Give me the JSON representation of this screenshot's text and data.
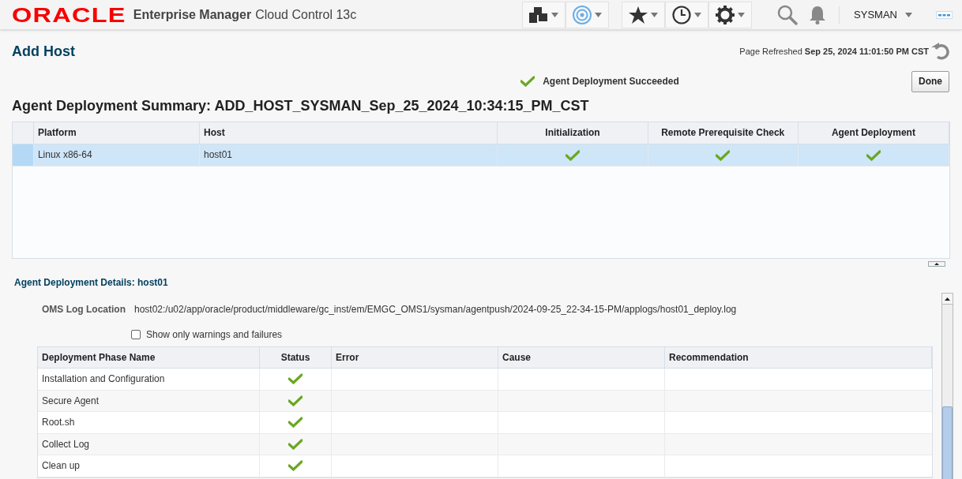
{
  "header": {
    "logo": "ORACLE",
    "product": "Enterprise Manager",
    "edition": "Cloud Control 13c",
    "user": "SYSMAN"
  },
  "page": {
    "title": "Add Host",
    "refreshed_label": "Page Refreshed",
    "refreshed_time": "Sep 25, 2024 11:01:50 PM CST"
  },
  "message": {
    "succeeded": true,
    "text": "Agent Deployment Succeeded"
  },
  "done_button": "Done",
  "summary": {
    "title": "Agent Deployment Summary: ADD_HOST_SYSMAN_Sep_25_2024_10:34:15_PM_CST",
    "columns": [
      "Platform",
      "Host",
      "Initialization",
      "Remote Prerequisite Check",
      "Agent Deployment"
    ],
    "rows": [
      {
        "selected": true,
        "platform": "Linux x86-64",
        "host": "host01",
        "initialization_succeeded": true,
        "prerequisite_succeeded": true,
        "deployment_succeeded": true
      }
    ]
  },
  "details": {
    "title": "Agent Deployment Details: host01",
    "log_label": "OMS Log Location",
    "log_value": "host02:/u02/app/oracle/product/middleware/gc_inst/em/EMGC_OMS1/sysman/agentpush/2024-09-25_22-34-15-PM/applogs/host01_deploy.log",
    "filter": {
      "label": "Show only warnings and failures",
      "checked": false
    },
    "columns": [
      "Deployment Phase Name",
      "Status",
      "Error",
      "Cause",
      "Recommendation"
    ],
    "rows": [
      {
        "name": "Installation and Configuration",
        "succeeded": true
      },
      {
        "name": "Secure Agent",
        "succeeded": true
      },
      {
        "name": "Root.sh",
        "succeeded": true
      },
      {
        "name": "Collect Log",
        "succeeded": true
      },
      {
        "name": "Clean up",
        "succeeded": true
      }
    ]
  }
}
